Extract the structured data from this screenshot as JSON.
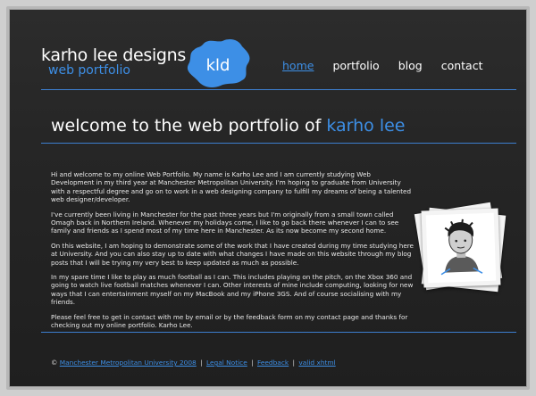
{
  "header": {
    "logo_title": "karho lee designs",
    "logo_subtitle": "web portfolio",
    "logo_badge": "kld"
  },
  "nav": {
    "items": [
      {
        "label": "home"
      },
      {
        "label": "portfolio"
      },
      {
        "label": "blog"
      },
      {
        "label": "contact"
      }
    ]
  },
  "main": {
    "heading_prefix": "welcome to the web portfolio of",
    "heading_name": "karho lee",
    "paragraphs": [
      "Hi and welcome to my online Web Portfolio. My name is Karho Lee and I am currently studying Web Development in my third year at Manchester Metropolitan University. I'm hoping to graduate from University with a respectful degree and go on to work in a web designing company to fulfill my dreams of being a talented web designer/developer.",
      "I've currently been living in Manchester for the past three years but I'm originally from a small town called Omagh back in Northern Ireland. Whenever my holidays come, I like to go back there whenever I can to see family and friends as I spend most of my time here in Manchester. As its now become my second home.",
      "On this website, I am hoping to demonstrate some of the work that I have created during my time studying here at University. And you can also stay up to date with what changes I have made on this website through my blog posts that I will be trying my very best to keep updated as much as possible.",
      "In my spare time I like to play as much football as I can. This includes playing on the pitch, on the Xbox 360 and going to watch live football matches whenever I can. Other interests of mine include computing, looking for new ways that I can entertainment myself on my MacBook and my iPhone 3GS. And of course socialising with my friends.",
      "Please feel free to get in contact with me by email or by the feedback form on my contact page and thanks for checking out my online portfolio. Karho Lee."
    ]
  },
  "footer": {
    "copyright": "©",
    "links": [
      {
        "label": "Manchester Metropolitan University 2008"
      },
      {
        "label": "Legal Notice"
      },
      {
        "label": "Feedback"
      },
      {
        "label": "valid xhtml"
      }
    ],
    "separator": "|"
  },
  "colors": {
    "accent": "#3d8fe6",
    "background": "#262626",
    "rule": "#3d7fd0"
  }
}
